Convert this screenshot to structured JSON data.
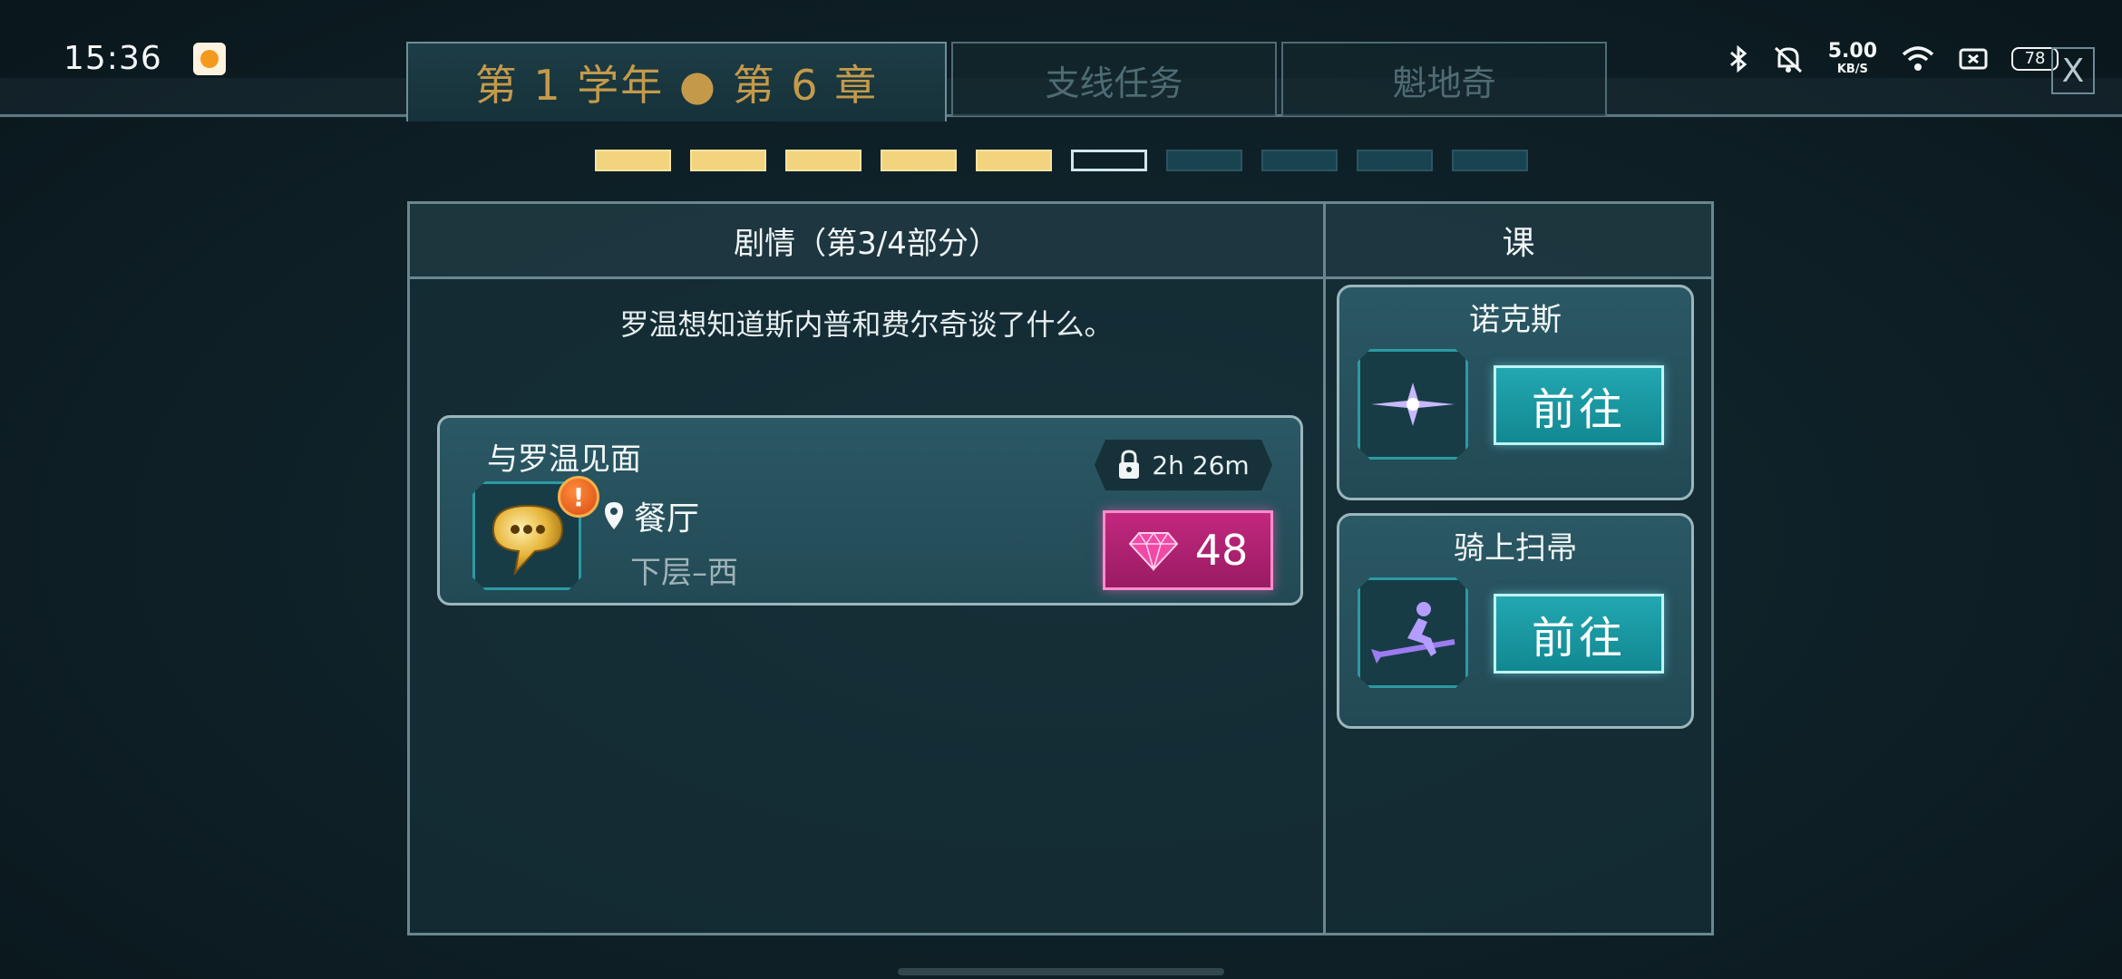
{
  "status_bar": {
    "time": "15:36",
    "network_speed": "5.00",
    "network_unit": "KB/S",
    "battery": "78"
  },
  "tabs": [
    {
      "label": "第 1 学年 ● 第 6 章",
      "active": true
    },
    {
      "label": "支线任务",
      "active": false
    },
    {
      "label": "魁地奇",
      "active": false
    }
  ],
  "close_label": "X",
  "progress": {
    "total": 10,
    "completed": 5,
    "current": 6
  },
  "story": {
    "title": "剧情（第3/4部分）",
    "description": "罗温想知道斯内普和费尔奇谈了什么。",
    "quest": {
      "title": "与罗温见面",
      "alert": "!",
      "location": "餐厅",
      "sublocation": "下层–西",
      "timer": "2h 26m",
      "gem_cost": "48"
    }
  },
  "lessons": {
    "title": "课",
    "items": [
      {
        "name": "诺克斯",
        "button": "前往",
        "icon": "spark-icon"
      },
      {
        "name": "骑上扫帚",
        "button": "前往",
        "icon": "broom-rider-icon"
      }
    ]
  },
  "colors": {
    "gold": "#c49a4a",
    "progress_done": "#f1d47d",
    "teal_button": "#22a7b1",
    "gem_button": "#c2287e"
  }
}
